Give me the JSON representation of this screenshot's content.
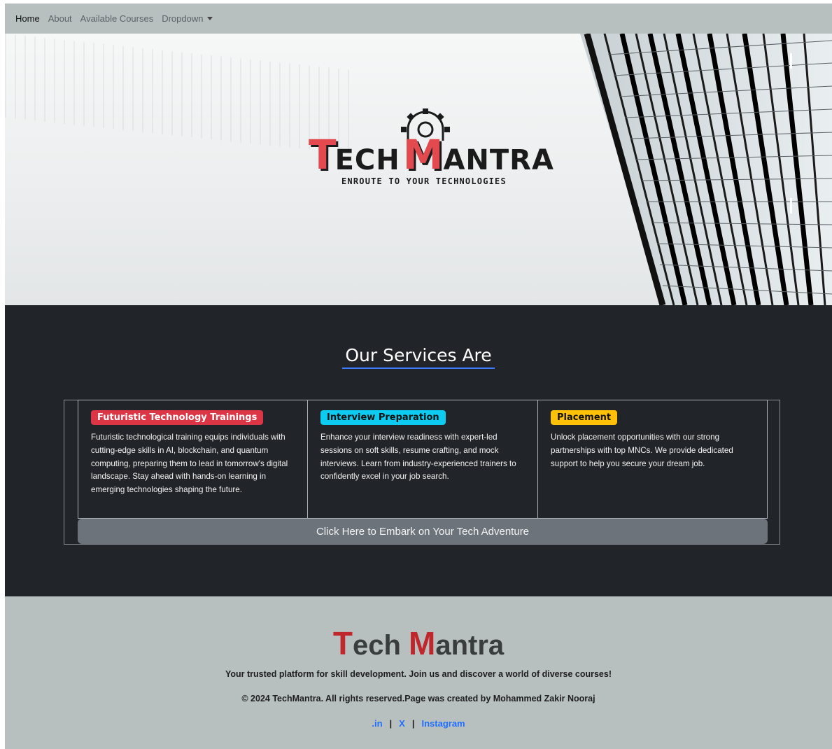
{
  "navbar": {
    "items": [
      {
        "label": "Home",
        "active": true
      },
      {
        "label": "About"
      },
      {
        "label": "Available Courses"
      },
      {
        "label": "Dropdown"
      }
    ]
  },
  "hero": {
    "logo_letter_t": "T",
    "logo_ech": "ECH",
    "logo_letter_m": "M",
    "logo_antra": "ANTRA",
    "logo_tagline": "ENROUTE TO YOUR TECHNOLOGIES"
  },
  "services": {
    "title": "Our Services Are",
    "cards": [
      {
        "badge": "Futuristic Technology Trainings",
        "badge_color": "#dc3545",
        "text": "Futuristic technological training equips individuals with cutting-edge skills in AI, blockchain, and quantum computing, preparing them to lead in tomorrow's digital landscape. Stay ahead with hands-on learning in emerging technologies shaping the future."
      },
      {
        "badge": "Interview Preparation",
        "badge_color": "#0dcaf0",
        "text": "Enhance your interview readiness with expert-led sessions on soft skills, resume crafting, and mock interviews. Learn from industry-experienced trainers to confidently excel in your job search."
      },
      {
        "badge": "Placement",
        "badge_color": "#ffc107",
        "text": "Unlock placement opportunities with our strong partnerships with top MNCs. We provide dedicated support to help you secure your dream job."
      }
    ],
    "cta": "Click Here to Embark on Your Tech Adventure"
  },
  "footer": {
    "brand_cap1": "T",
    "brand_rest1": "ech ",
    "brand_cap2": "M",
    "brand_rest2": "antra",
    "tagline": "Your trusted platform for skill development. Join us and discover a world of diverse courses!",
    "copyright": "© 2024 TechMantra. All rights reserved.Page was created by Mohammed Zakir Nooraj",
    "links": [
      ".in",
      "X",
      "Instagram"
    ],
    "separator": "|"
  },
  "colors": {
    "navbar_bg": "#b8c0bf",
    "services_bg": "#212529",
    "accent_red": "#c0272d",
    "link_blue": "#1e6fff"
  }
}
